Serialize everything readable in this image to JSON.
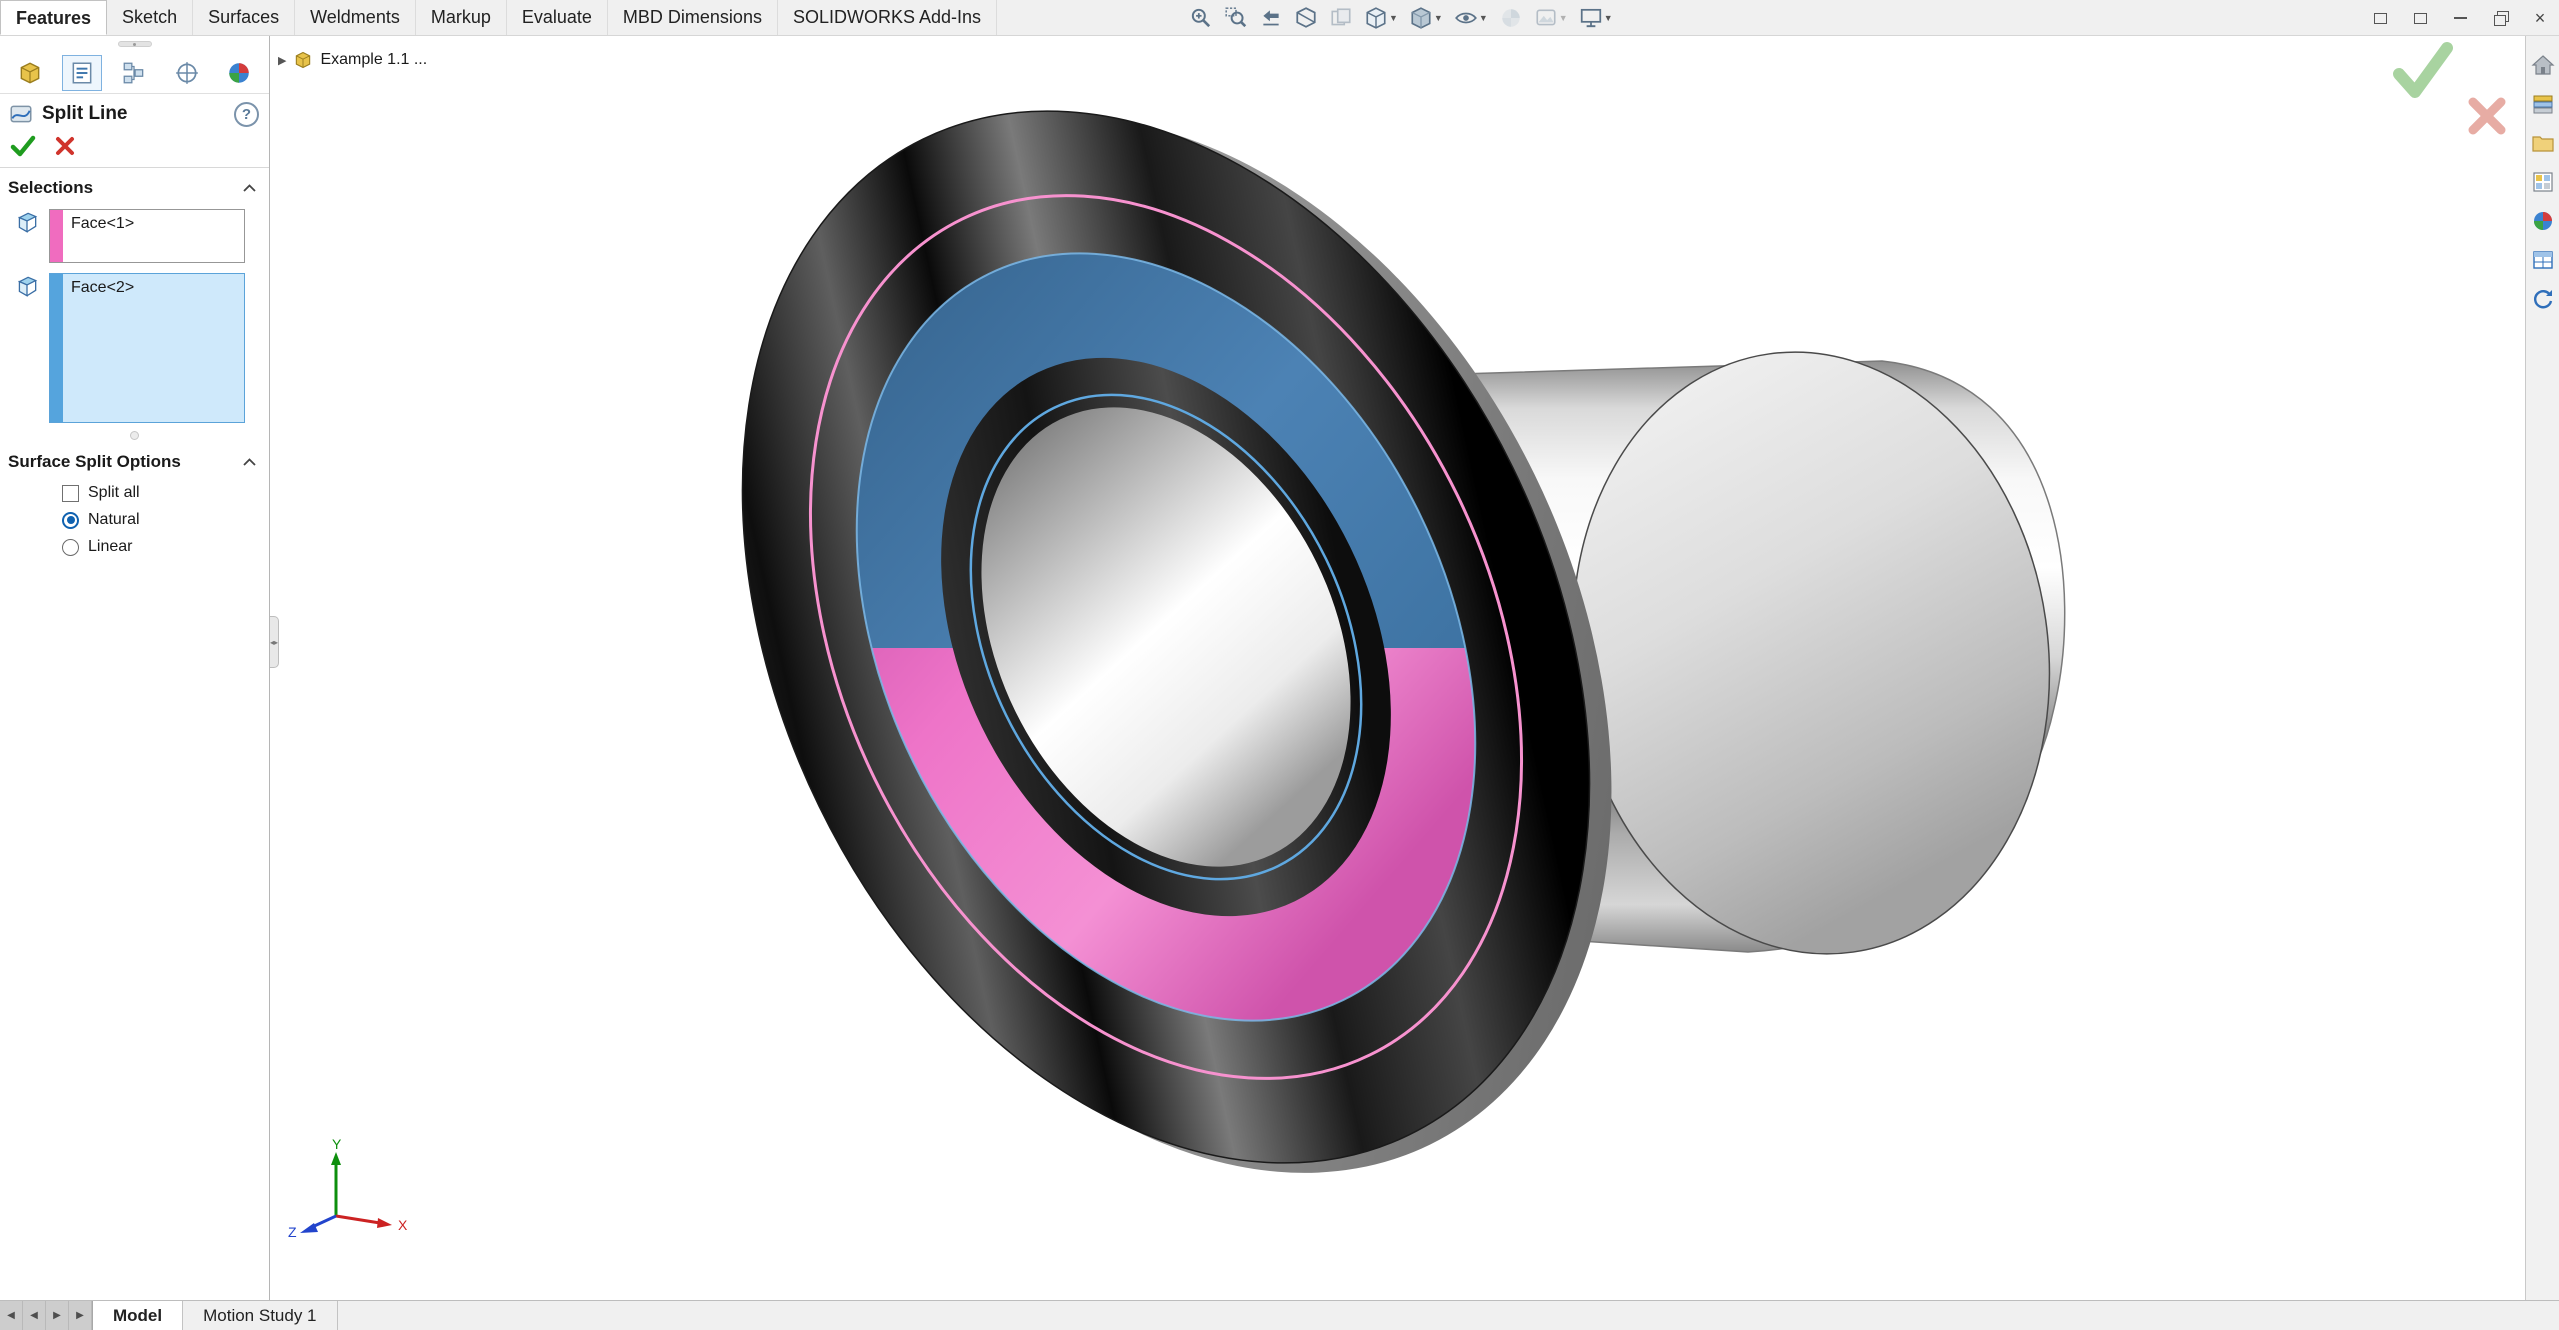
{
  "ribbon": {
    "tabs": [
      {
        "label": "Features",
        "active": true
      },
      {
        "label": "Sketch",
        "active": false
      },
      {
        "label": "Surfaces",
        "active": false
      },
      {
        "label": "Weldments",
        "active": false
      },
      {
        "label": "Markup",
        "active": false
      },
      {
        "label": "Evaluate",
        "active": false
      },
      {
        "label": "MBD Dimensions",
        "active": false
      },
      {
        "label": "SOLIDWORKS Add-Ins",
        "active": false
      }
    ],
    "heads_up_icons": [
      "zoom-to-fit",
      "zoom-to-area",
      "previous-view",
      "section-view",
      "3d-drawing-view",
      "view-orientation",
      "display-style",
      "hide-show-items",
      "edit-appearance",
      "apply-scene",
      "view-settings"
    ],
    "dropdown_caret": "▼"
  },
  "window_controls": [
    "collapse-ribbon",
    "fullscreen",
    "minimize",
    "restore",
    "close"
  ],
  "property_manager": {
    "tabs": [
      "feature-manager",
      "property-manager",
      "configuration-manager",
      "dimxpert-manager",
      "display-manager"
    ],
    "title": "Split Line",
    "help_glyph": "?",
    "selections": {
      "header": "Selections",
      "items": [
        {
          "label": "Face<1>",
          "swatch_color": "#f06cbf",
          "selected": false
        },
        {
          "label": "Face<2>",
          "swatch_color": "#55a4dd",
          "selected": true
        }
      ]
    },
    "surface_split_options": {
      "header": "Surface Split Options",
      "split_all": {
        "label": "Split all",
        "checked": false
      },
      "natural": {
        "label": "Natural",
        "checked": true
      },
      "linear": {
        "label": "Linear",
        "checked": false
      }
    }
  },
  "viewport": {
    "tree_item": "Example 1.1 ...",
    "collapsed_arrow": "▶",
    "triad": {
      "x": "X",
      "y": "Y",
      "z": "Z"
    },
    "confirmation_corner": [
      "ok",
      "cancel"
    ]
  },
  "task_pane_icons": [
    "home",
    "design-library",
    "file-explorer",
    "view-palette",
    "appearances",
    "custom-properties",
    "solidworks-forum"
  ],
  "status_bar": {
    "nav_glyphs": [
      "◀",
      "◀",
      "▶",
      "▶"
    ],
    "tabs": [
      {
        "label": "Model",
        "active": true
      },
      {
        "label": "Motion Study 1",
        "active": false
      }
    ]
  },
  "colors": {
    "selection_highlight": "#cfe9fb",
    "face1_pink": "#e86cc2",
    "face2_blue": "#4b7ea8",
    "ok_green": "#2e9e2e",
    "cancel_red": "#d0342c",
    "panel_border": "#b5b5b5"
  }
}
